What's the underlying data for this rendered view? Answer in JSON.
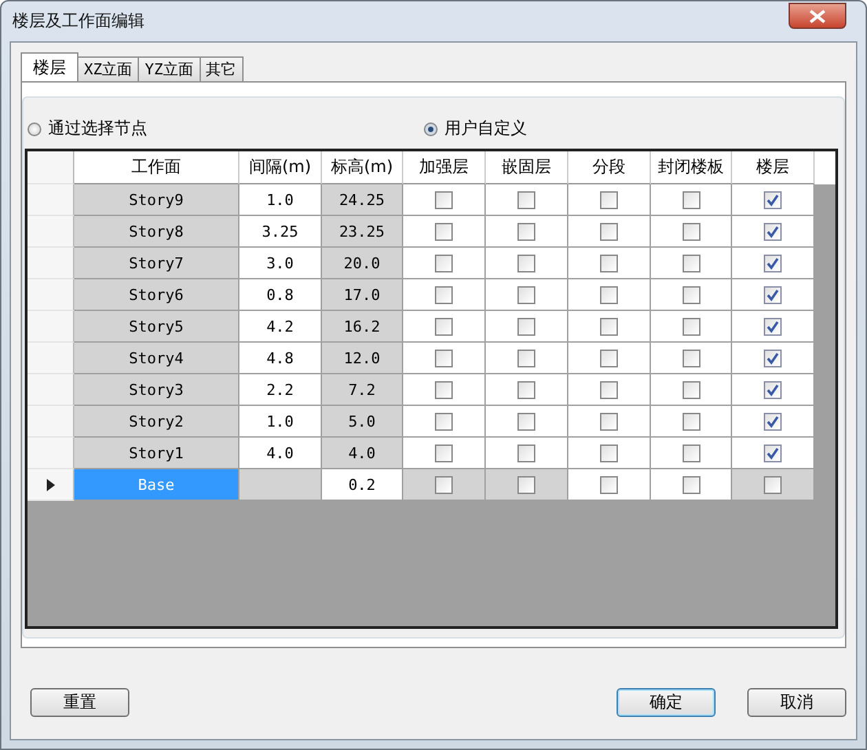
{
  "window": {
    "title": "楼层及工作面编辑"
  },
  "tabs": [
    {
      "label": "楼层",
      "selected": true
    },
    {
      "label": "XZ立面",
      "selected": false
    },
    {
      "label": "YZ立面",
      "selected": false
    },
    {
      "label": "其它",
      "selected": false
    }
  ],
  "radios": [
    {
      "label": "通过选择节点",
      "selected": false
    },
    {
      "label": "用户自定义",
      "selected": true
    }
  ],
  "table": {
    "columns": [
      "工作面",
      "间隔(m)",
      "标高(m)",
      "加强层",
      "嵌固层",
      "分段",
      "封闭楼板",
      "楼层"
    ],
    "rows": [
      {
        "kind": "story",
        "current": false,
        "name": "Story9",
        "spacing": "1.0",
        "elevation": "24.25",
        "checks": [
          false,
          false,
          false,
          false,
          true
        ]
      },
      {
        "kind": "story",
        "current": false,
        "name": "Story8",
        "spacing": "3.25",
        "elevation": "23.25",
        "checks": [
          false,
          false,
          false,
          false,
          true
        ]
      },
      {
        "kind": "story",
        "current": false,
        "name": "Story7",
        "spacing": "3.0",
        "elevation": "20.0",
        "checks": [
          false,
          false,
          false,
          false,
          true
        ]
      },
      {
        "kind": "story",
        "current": false,
        "name": "Story6",
        "spacing": "0.8",
        "elevation": "17.0",
        "checks": [
          false,
          false,
          false,
          false,
          true
        ]
      },
      {
        "kind": "story",
        "current": false,
        "name": "Story5",
        "spacing": "4.2",
        "elevation": "16.2",
        "checks": [
          false,
          false,
          false,
          false,
          true
        ]
      },
      {
        "kind": "story",
        "current": false,
        "name": "Story4",
        "spacing": "4.8",
        "elevation": "12.0",
        "checks": [
          false,
          false,
          false,
          false,
          true
        ]
      },
      {
        "kind": "story",
        "current": false,
        "name": "Story3",
        "spacing": "2.2",
        "elevation": "7.2",
        "checks": [
          false,
          false,
          false,
          false,
          true
        ]
      },
      {
        "kind": "story",
        "current": false,
        "name": "Story2",
        "spacing": "1.0",
        "elevation": "5.0",
        "checks": [
          false,
          false,
          false,
          false,
          true
        ]
      },
      {
        "kind": "story",
        "current": false,
        "name": "Story1",
        "spacing": "4.0",
        "elevation": "4.0",
        "checks": [
          false,
          false,
          false,
          false,
          true
        ]
      },
      {
        "kind": "base",
        "current": true,
        "name": "Base",
        "elevation": "0.2",
        "checks": [
          false,
          false,
          false,
          false,
          false
        ]
      }
    ]
  },
  "buttons": [
    {
      "label": "重置",
      "default": false
    },
    {
      "label": "确定",
      "default": true
    },
    {
      "label": "取消",
      "default": false
    }
  ]
}
